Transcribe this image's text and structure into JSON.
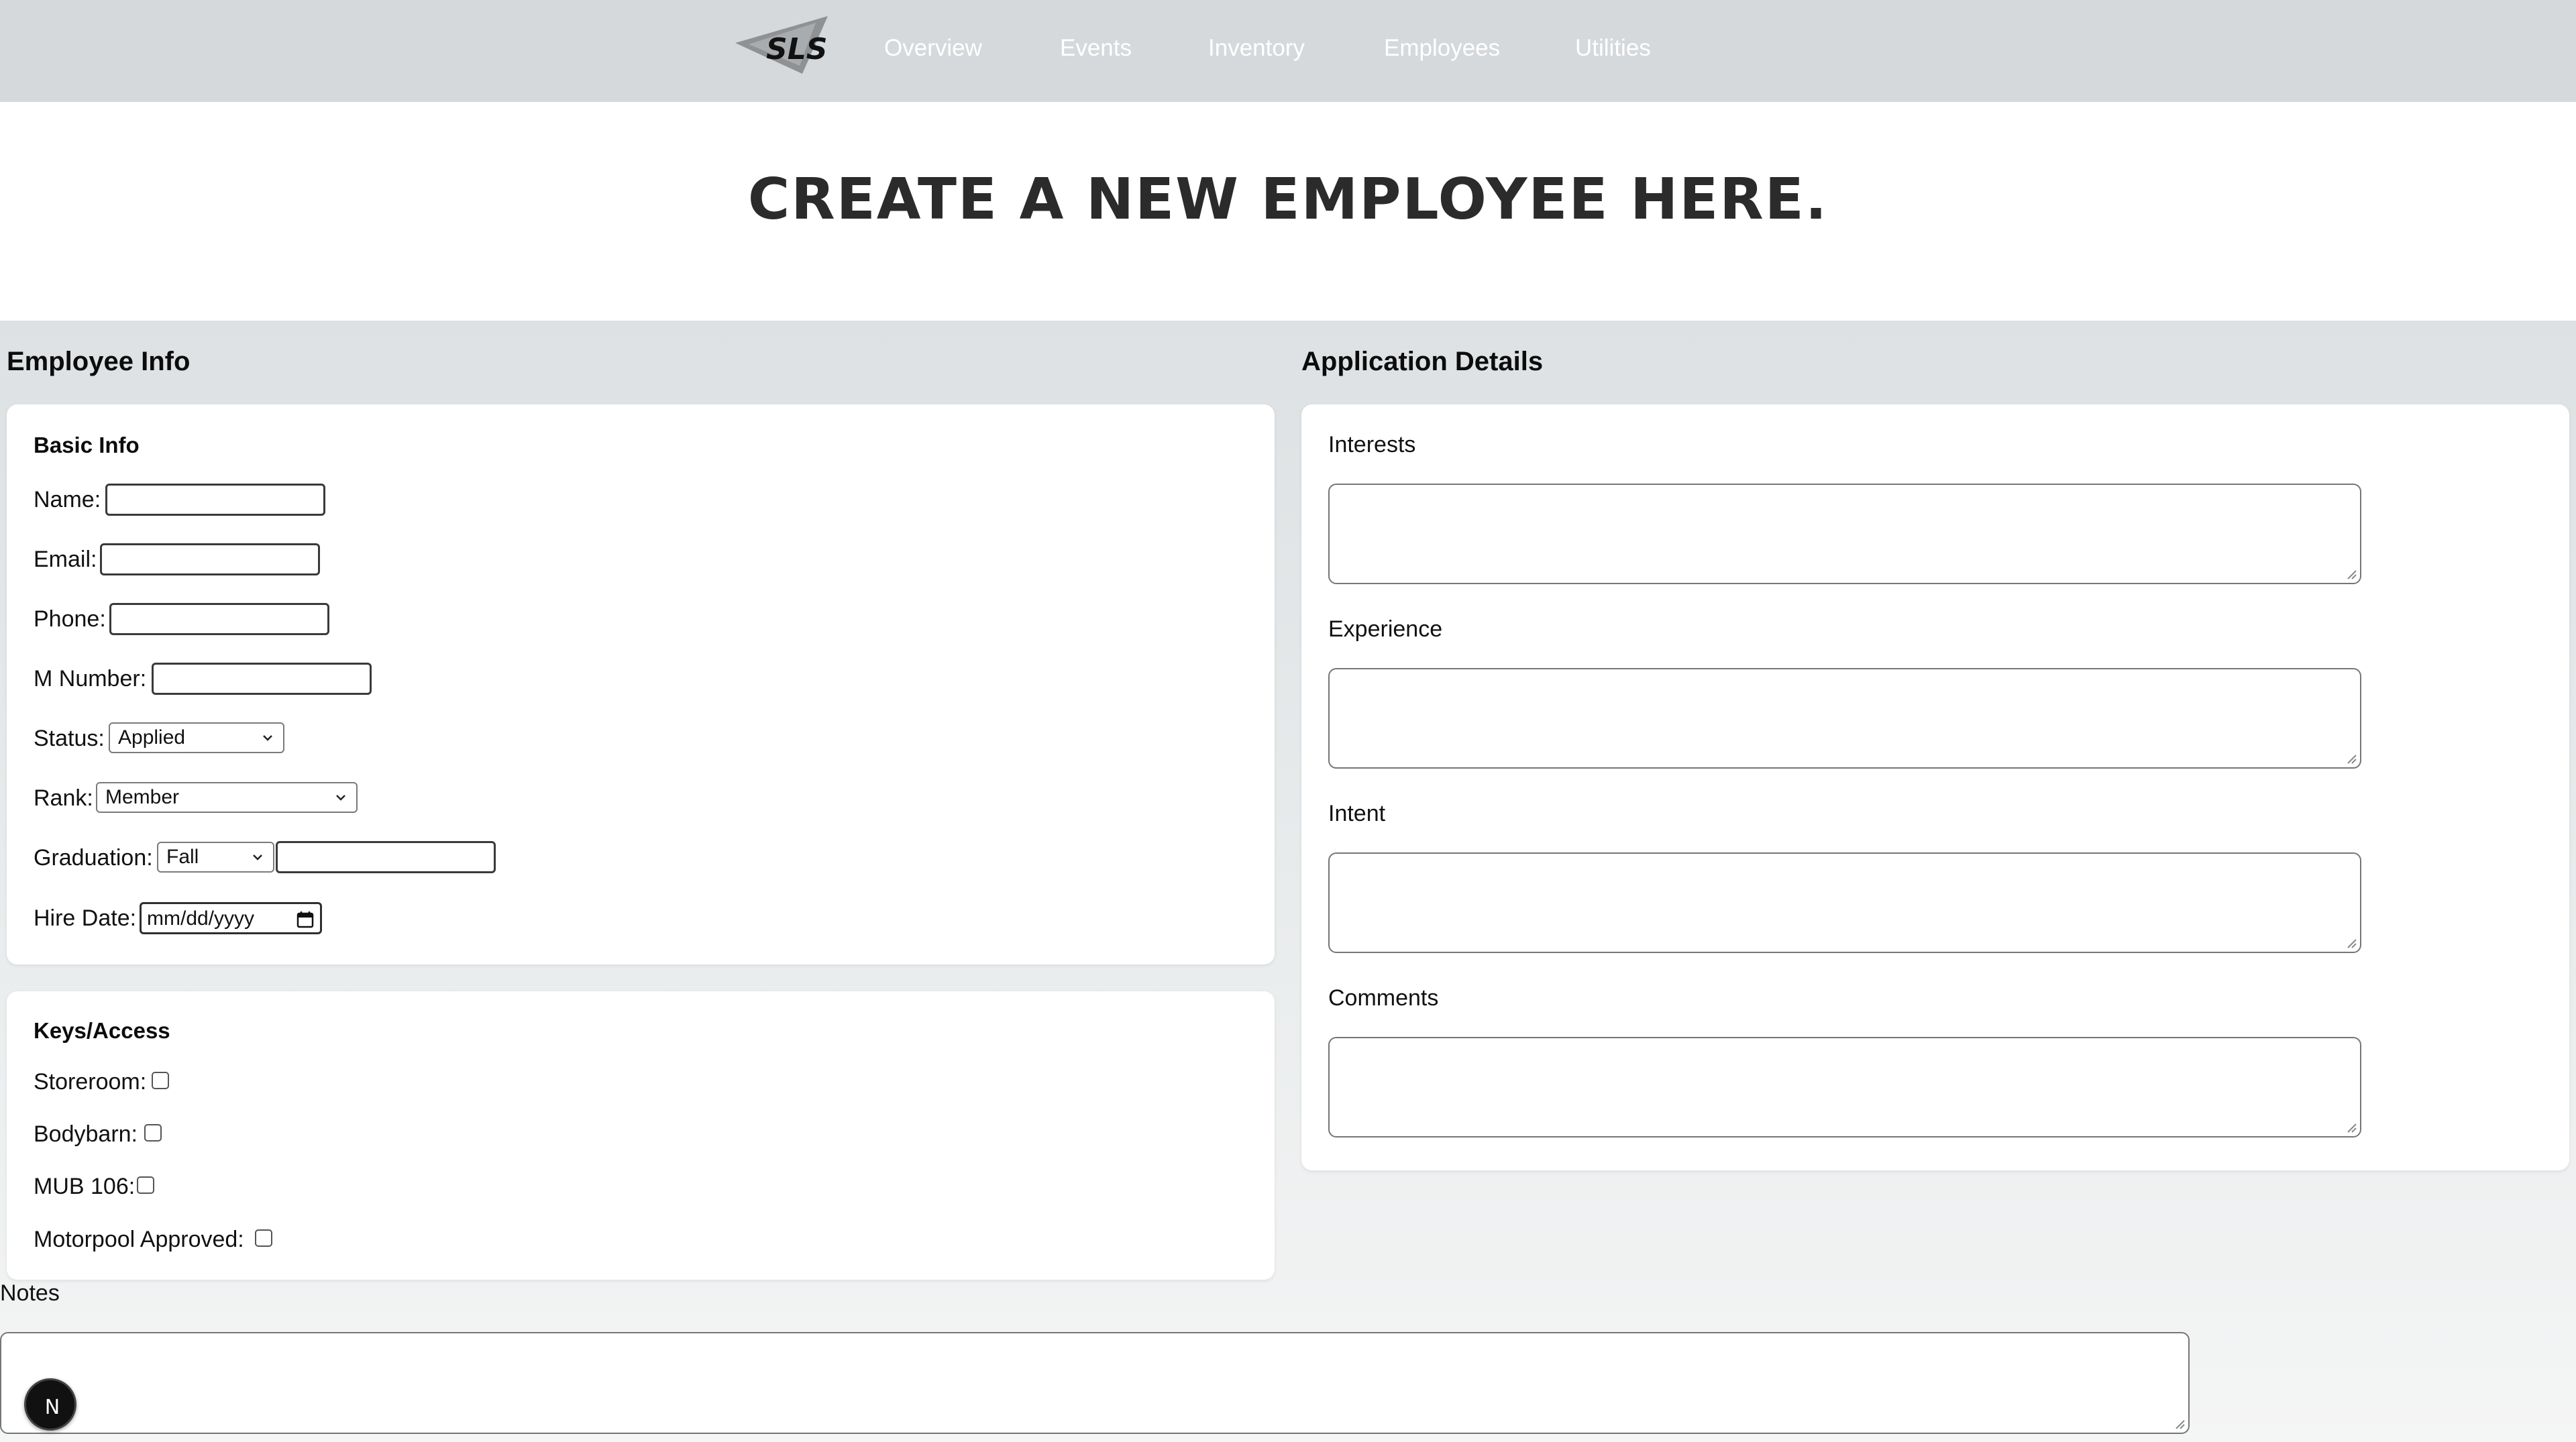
{
  "nav": {
    "logo_text": "SLS",
    "links": [
      "Overview",
      "Events",
      "Inventory",
      "Employees",
      "Utilities"
    ]
  },
  "page": {
    "title": "CREATE A NEW EMPLOYEE HERE."
  },
  "employee_info": {
    "heading": "Employee Info",
    "basic_info": {
      "title": "Basic Info",
      "name_label": "Name:",
      "email_label": "Email:",
      "phone_label": "Phone:",
      "m_number_label": "M Number:",
      "status_label": "Status:",
      "status_value": "Applied",
      "rank_label": "Rank:",
      "rank_value": "Member",
      "graduation_label": "Graduation:",
      "graduation_term": "Fall",
      "hire_date_label": "Hire Date:",
      "hire_date_placeholder": "mm/dd/yyyy"
    },
    "keys_access": {
      "title": "Keys/Access",
      "storeroom_label": "Storeroom:",
      "bodybarn_label": "Bodybarn:",
      "mub106_label": "MUB 106:",
      "motorpool_label": "Motorpool Approved:"
    }
  },
  "application_details": {
    "heading": "Application Details",
    "interests_label": "Interests",
    "experience_label": "Experience",
    "intent_label": "Intent",
    "comments_label": "Comments"
  },
  "notes": {
    "label": "Notes"
  },
  "badge": {
    "letter": "N"
  },
  "colors": {
    "nav_bg": "#d6d9db",
    "content_bg": "#dde1e3",
    "title_text": "#2b2b2b",
    "card_bg": "#ffffff"
  }
}
